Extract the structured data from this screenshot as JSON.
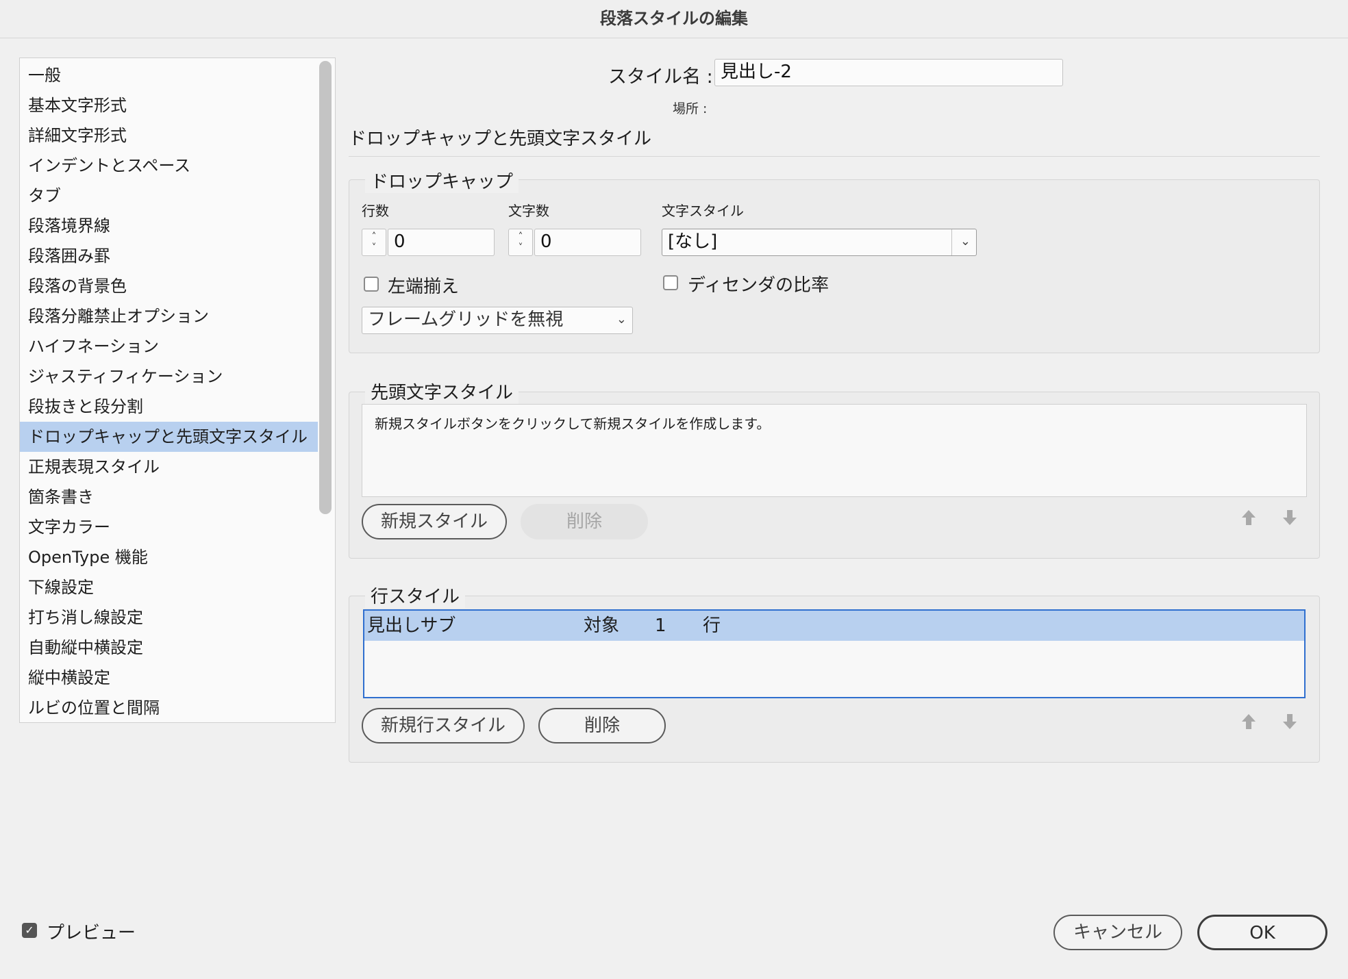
{
  "window": {
    "title": "段落スタイルの編集"
  },
  "sidebar": {
    "items": [
      {
        "label": "一般"
      },
      {
        "label": "基本文字形式"
      },
      {
        "label": "詳細文字形式"
      },
      {
        "label": "インデントとスペース"
      },
      {
        "label": "タブ"
      },
      {
        "label": "段落境界線"
      },
      {
        "label": "段落囲み罫"
      },
      {
        "label": "段落の背景色"
      },
      {
        "label": "段落分離禁止オプション"
      },
      {
        "label": "ハイフネーション"
      },
      {
        "label": "ジャスティフィケーション"
      },
      {
        "label": "段抜きと段分割"
      },
      {
        "label": "ドロップキャップと先頭文字スタイル",
        "selected": true
      },
      {
        "label": "正規表現スタイル"
      },
      {
        "label": "箇条書き"
      },
      {
        "label": "文字カラー"
      },
      {
        "label": "OpenType 機能"
      },
      {
        "label": "下線設定"
      },
      {
        "label": "打ち消し線設定"
      },
      {
        "label": "自動縦中横設定"
      },
      {
        "label": "縦中横設定"
      },
      {
        "label": "ルビの位置と間隔"
      }
    ]
  },
  "header": {
    "style_name_label": "スタイル名 :",
    "style_name_value": "見出し-2",
    "location_label": "場所 :",
    "section_heading": "ドロップキャップと先頭文字スタイル"
  },
  "dropcap": {
    "title": "ドロップキャップ",
    "lines_label": "行数",
    "lines_value": "0",
    "chars_label": "文字数",
    "chars_value": "0",
    "char_style_label": "文字スタイル",
    "char_style_value": "[なし]",
    "align_left_label": "左端揃え",
    "align_left_checked": false,
    "descender_label": "ディセンダの比率",
    "descender_checked": false,
    "grid_option_value": "フレームグリッドを無視"
  },
  "nested_styles": {
    "title": "先頭文字スタイル",
    "empty_message": "新規スタイルボタンをクリックして新規スタイルを作成します。",
    "new_button": "新規スタイル",
    "delete_button": "削除"
  },
  "line_styles": {
    "title": "行スタイル",
    "rows": [
      {
        "style": "見出しサブ",
        "through": "対象",
        "count": "1",
        "unit": "行"
      }
    ],
    "new_button": "新規行スタイル",
    "delete_button": "削除"
  },
  "footer": {
    "preview_label": "プレビュー",
    "preview_checked": true,
    "cancel_button": "キャンセル",
    "ok_button": "OK"
  },
  "colors": {
    "selection": "#b8d0ef",
    "background": "#f0f0f0"
  }
}
